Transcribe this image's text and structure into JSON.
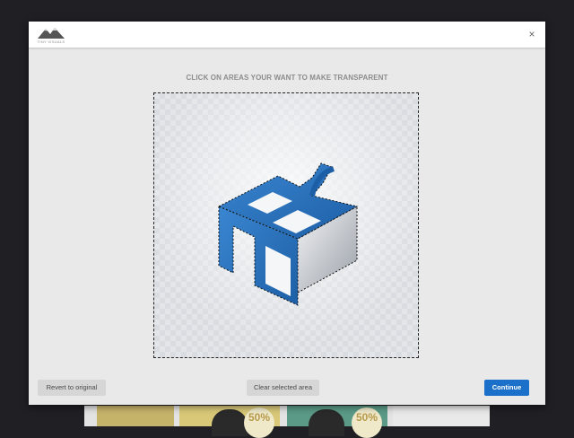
{
  "background": {
    "badges": [
      "50%",
      "50%"
    ]
  },
  "modal": {
    "logo_text": "TINY VISUALS",
    "close_label": "×",
    "instruction": "CLICK ON AREAS YOUR WANT TO MAKE TRANSPARENT",
    "buttons": {
      "revert": "Revert to original",
      "clear": "Clear selected area",
      "continue": "Continue"
    },
    "colors": {
      "accent": "#1b70c9",
      "logo_blue": "#2a6fb8"
    },
    "icons": [
      "mountain-logo-icon",
      "close-icon"
    ]
  }
}
